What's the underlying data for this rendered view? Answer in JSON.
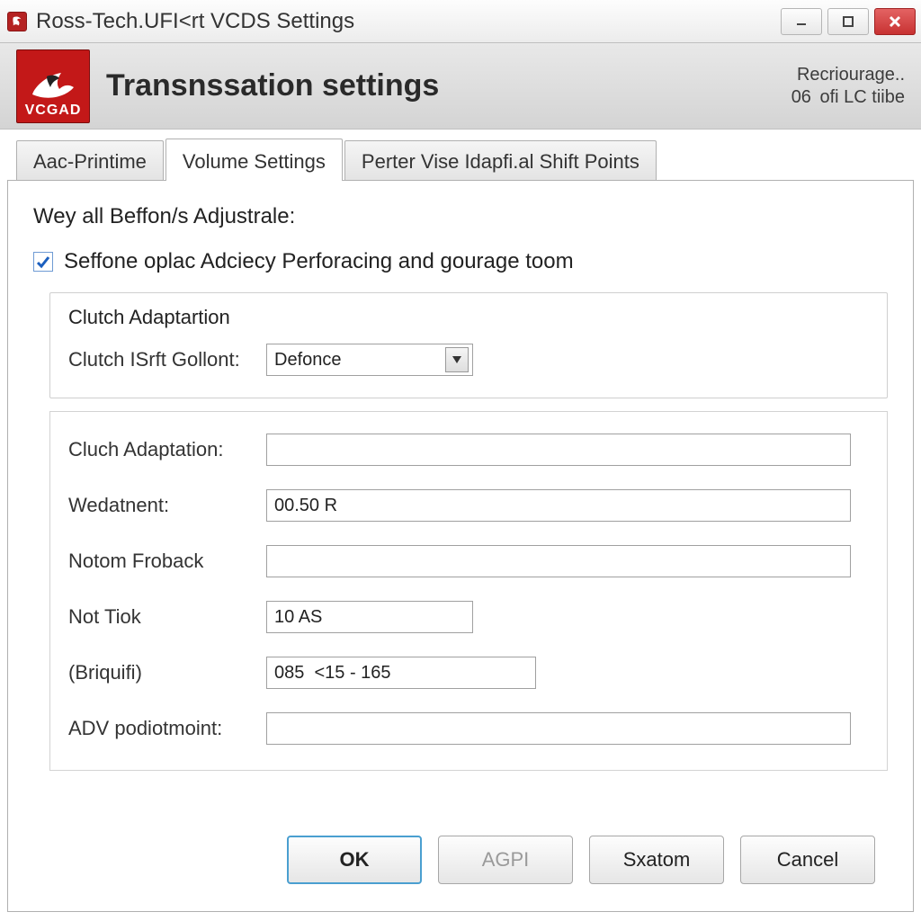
{
  "window": {
    "title": "Ross-Tech.UFI<rt VCDS Settings"
  },
  "header": {
    "logo_text": "VCGAD",
    "title": "Transnssation settings",
    "status_line1": "Recriourage..",
    "status_line2": "06  ofi LC tiibe"
  },
  "tabs": [
    {
      "label": "Aac-Printime",
      "active": false
    },
    {
      "label": "Volume Settings",
      "active": true
    },
    {
      "label": "Perter Vise Idapfi.al Shift Points",
      "active": false
    }
  ],
  "panel": {
    "section_heading": "Wey all Beffon/s Adjustrale:",
    "checkbox_label": "Seffone oplac Adciecy Perforacing and gourage toom",
    "checkbox_checked": true,
    "group_title": "Clutch Adaptartion",
    "combo_label": "Clutch ISrft Gollont:",
    "combo_value": "Defonce",
    "params": [
      {
        "label": "Cluch Adaptation:",
        "value": ""
      },
      {
        "label": "Wedatnent:",
        "value": "00.50 R"
      },
      {
        "label": "Notom Froback",
        "value": ""
      },
      {
        "label": "Not Tiok",
        "value": "10 AS"
      },
      {
        "label": "(Briquifi)",
        "value": "085  <15 - 165"
      },
      {
        "label": "ADV podiotmoint:",
        "value": ""
      }
    ]
  },
  "footer": {
    "ok": "OK",
    "agpi": "AGPI",
    "sxatom": "Sxatom",
    "cancel": "Cancel"
  }
}
